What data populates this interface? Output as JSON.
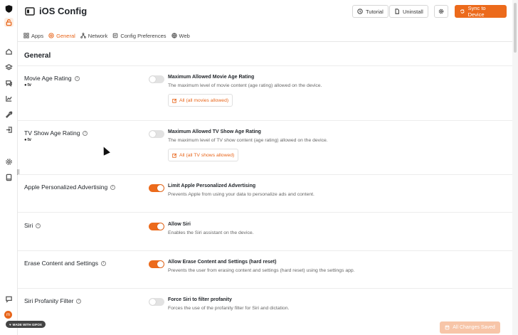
{
  "header": {
    "title": "iOS Config",
    "tutorial_label": "Tutorial",
    "uninstall_label": "Uninstall",
    "sync_label": "Sync to Device"
  },
  "tabs": [
    {
      "label": "Apps",
      "icon": "grid-icon"
    },
    {
      "label": "General",
      "icon": "target-icon",
      "active": true
    },
    {
      "label": "Network",
      "icon": "network-icon"
    },
    {
      "label": "Config Preferences",
      "icon": "config-icon"
    },
    {
      "label": "Web",
      "icon": "globe-icon"
    }
  ],
  "section_title": "General",
  "settings": [
    {
      "label": "Movie Age Rating",
      "platform": "tv",
      "enabled": false,
      "option": "Maximum Allowed Movie Age Rating",
      "description": "The maximum level of movie content (age rating) allowed on the device.",
      "select": "All (all movies allowed)"
    },
    {
      "label": "TV Show Age Rating",
      "platform": "tv",
      "enabled": false,
      "option": "Maximum Allowed TV Show Age Rating",
      "description": "The maximum level of TV show content (age rating) allowed on the device.",
      "select": "All (all TV shows allowed)"
    },
    {
      "label": "Apple Personalized Advertising",
      "enabled": true,
      "option": "Limit Apple Personalized Advertising",
      "description": "Prevents Apple from using your data to personalize ads and content."
    },
    {
      "label": "Siri",
      "enabled": true,
      "option": "Allow Siri",
      "description": "Enables the Siri assistant on the device."
    },
    {
      "label": "Erase Content and Settings",
      "enabled": true,
      "option": "Allow Erase Content and Settings (hard reset)",
      "description": "Prevents the user from erasing content and settings (hard reset) using the settings app."
    },
    {
      "label": "Siri Profanity Filter",
      "enabled": false,
      "option": "Force Siri to filter profanity",
      "description": "Forces the use of the profanity filter for Siri and dictation."
    }
  ],
  "footer": {
    "badge": "MADE WITH GIFOX",
    "saved_label": "All Changes Saved",
    "avatar_initial": "m"
  },
  "colors": {
    "accent": "#ec6a1b"
  }
}
